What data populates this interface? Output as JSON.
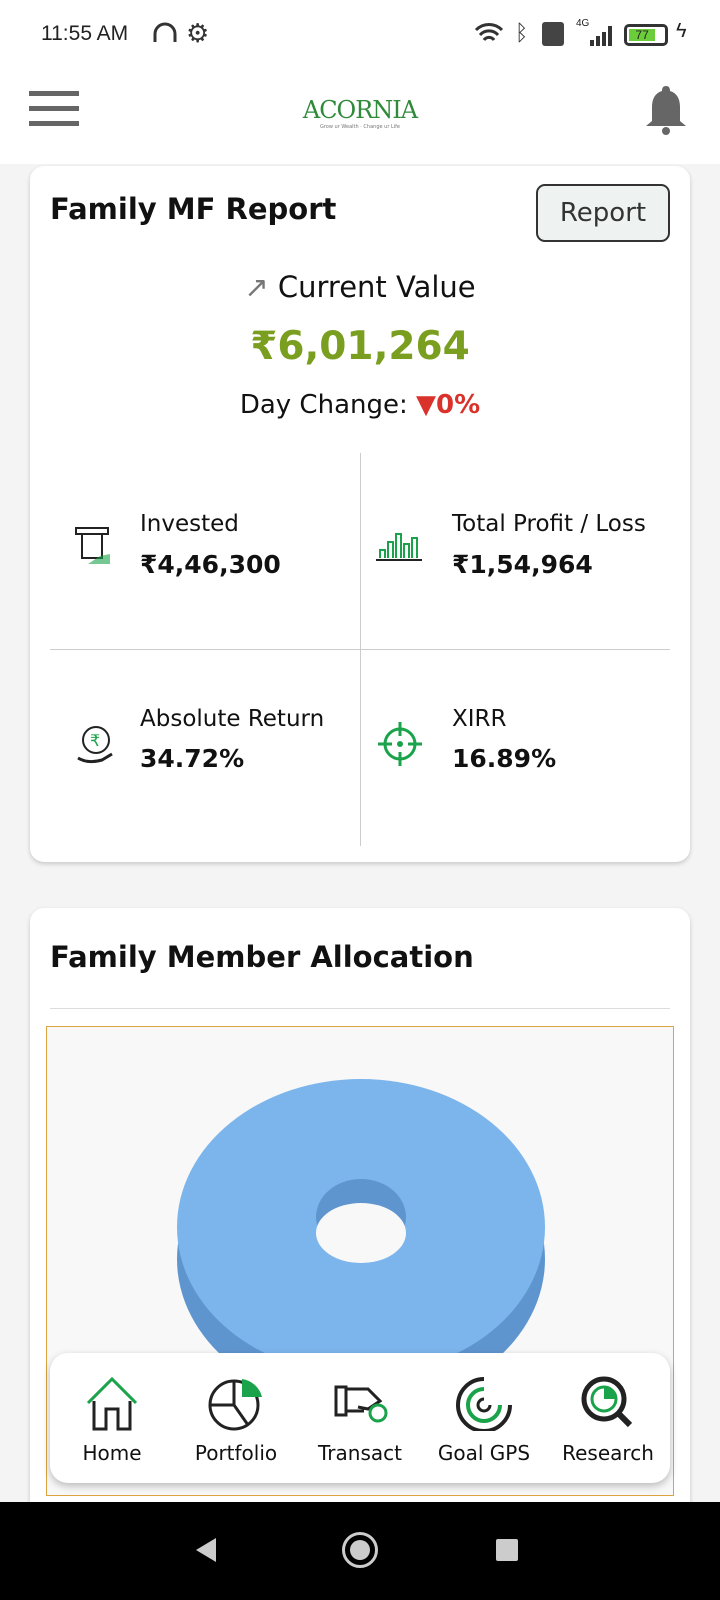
{
  "status_bar": {
    "time": "11:55 AM",
    "battery": "77",
    "network": "4G"
  },
  "header": {
    "logo": "ACORNIA",
    "logo_tagline": "Grow ur Wealth · Change ur Life"
  },
  "report_card": {
    "title": "Family MF Report",
    "report_button": "Report",
    "current_value_label": "Current Value",
    "current_value": "₹6,01,264",
    "day_change_label": "Day Change:",
    "day_change": "0%",
    "stats": [
      {
        "label": "Invested",
        "value": "₹4,46,300",
        "icon": "cash-hand-icon"
      },
      {
        "label": "Total Profit / Loss",
        "value": "₹1,54,964",
        "icon": "bar-chart-icon"
      },
      {
        "label": "Absolute Return",
        "value": "34.72%",
        "icon": "rupee-hand-icon"
      },
      {
        "label": "XIRR",
        "value": "16.89%",
        "icon": "target-icon"
      }
    ]
  },
  "allocation_card": {
    "title": "Family Member Allocation"
  },
  "colors": {
    "green": "#7a9e1f",
    "red": "#d8322b",
    "pie": "#7cb5ec",
    "accent": "#1aa34a"
  },
  "bottom_nav": [
    {
      "label": "Home"
    },
    {
      "label": "Portfolio"
    },
    {
      "label": "Transact"
    },
    {
      "label": "Goal GPS"
    },
    {
      "label": "Research"
    }
  ]
}
